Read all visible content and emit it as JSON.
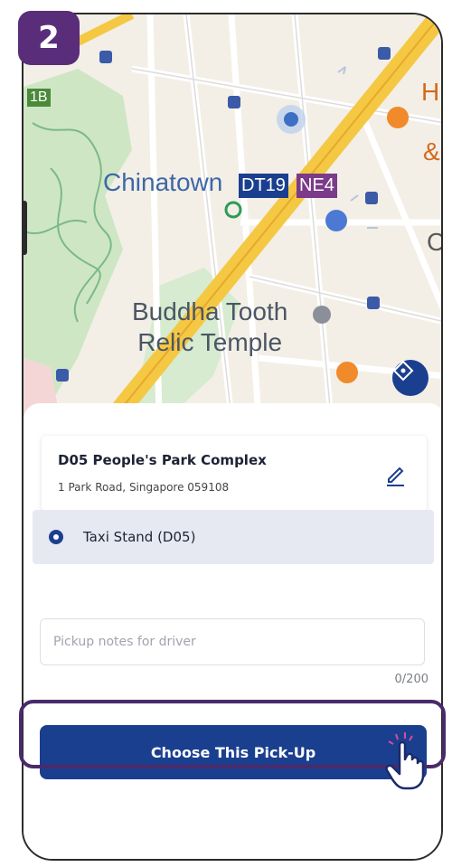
{
  "step_badge": "2",
  "map": {
    "area_label": "Chinatown",
    "mrt_codes": [
      "DT19",
      "NE4"
    ],
    "landmark_line1": "Buddha Tooth",
    "landmark_line2": "Relic Temple",
    "edge_letters": [
      "H",
      "&",
      "C"
    ],
    "route_badge": "1B"
  },
  "location": {
    "title": "D05 People's Park Complex",
    "address": "1 Park Road, Singapore 059108"
  },
  "pickup_point": {
    "label": "Taxi Stand (D05)"
  },
  "notes": {
    "placeholder": "Pickup notes for driver",
    "value": "",
    "counter": "0/200"
  },
  "actions": {
    "choose_label": "Choose This Pick-Up"
  },
  "colors": {
    "primary": "#1b3f8f",
    "badge": "#5a2d7a",
    "highlight": "#4a2a6a"
  }
}
